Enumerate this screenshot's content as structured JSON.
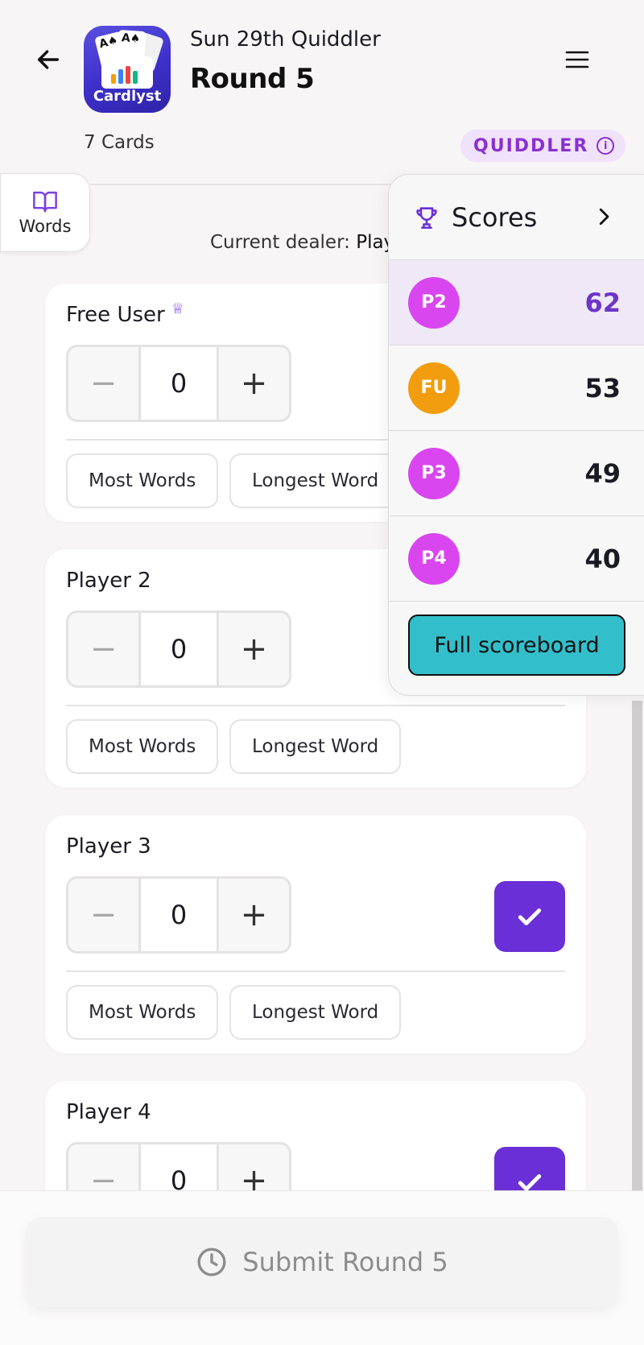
{
  "header": {
    "game_title": "Sun 29th Quiddler",
    "round_title": "Round 5",
    "cards_label": "7 Cards",
    "game_badge": "QUIDDLER",
    "app_icon_brand": "Cardlyst"
  },
  "words_tab": {
    "label": "Words"
  },
  "dealer": {
    "prefix": "Current dealer:",
    "name": "Play"
  },
  "players": [
    {
      "name": "Free User",
      "score_input": "0",
      "chips": [
        "Most Words",
        "Longest Word"
      ]
    },
    {
      "name": "Player 2",
      "score_input": "0",
      "chips": [
        "Most Words",
        "Longest Word"
      ]
    },
    {
      "name": "Player 3",
      "score_input": "0",
      "chips": [
        "Most Words",
        "Longest Word"
      ]
    },
    {
      "name": "Player 4",
      "score_input": "0"
    }
  ],
  "stepper": {
    "minus": "−",
    "plus": "+"
  },
  "scores": {
    "title": "Scores",
    "rows": [
      {
        "initials": "P2",
        "score": "62",
        "avatar_color": "#d946ef",
        "score_color": "#6d35c9",
        "highlight": true
      },
      {
        "initials": "FU",
        "score": "53",
        "avatar_color": "#f29d0f",
        "score_color": "#111111"
      },
      {
        "initials": "P3",
        "score": "49",
        "avatar_color": "#d946ef",
        "score_color": "#111111"
      },
      {
        "initials": "P4",
        "score": "40",
        "avatar_color": "#d946ef",
        "score_color": "#111111"
      }
    ],
    "full_button": "Full scoreboard"
  },
  "submit": {
    "label": "Submit Round 5"
  },
  "colors": {
    "accent_purple": "#6a2fd6",
    "badge_purple": "#8b2fd0",
    "teal_button": "#32bfcb"
  }
}
